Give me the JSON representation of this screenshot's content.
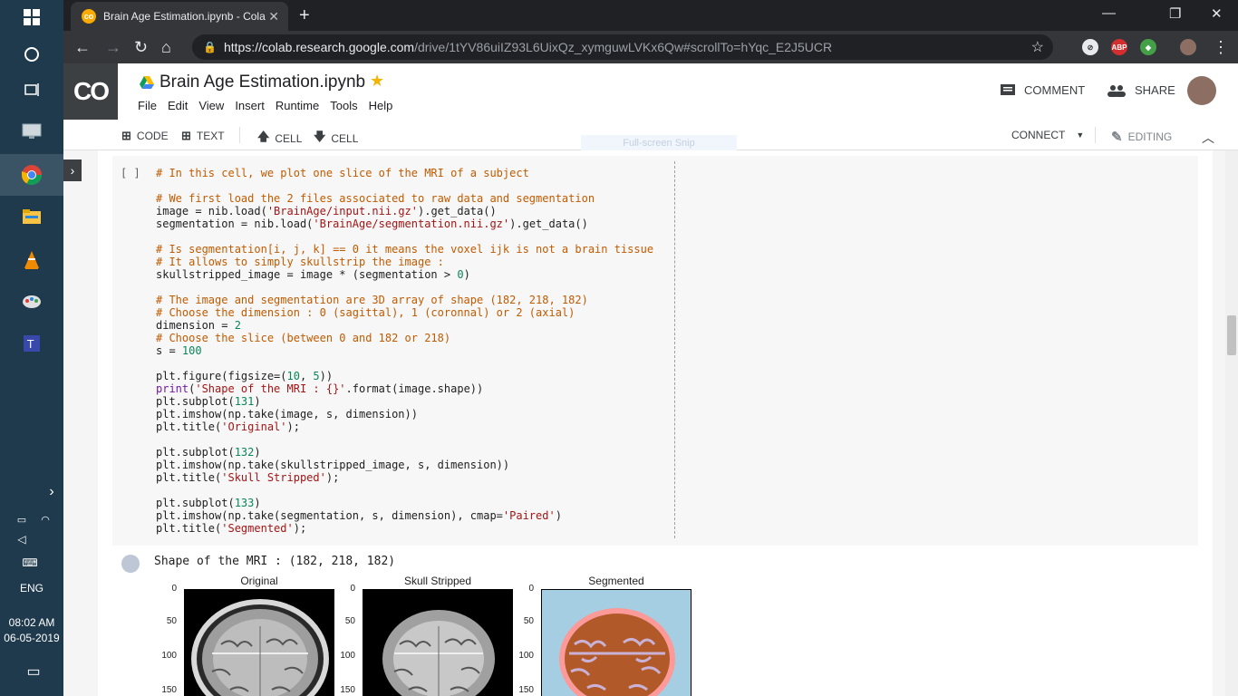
{
  "taskbar": {
    "time": "08:02 AM",
    "date": "06-05-2019",
    "language": "ENG"
  },
  "browser": {
    "tab_title": "Brain Age Estimation.ipynb - Cola",
    "url_host": "https://colab.research.google.com",
    "url_path": "/drive/1tYV86uiIZ93L6UixQz_xymguwLVKx6Qw#scrollTo=hYqc_E2J5UCR",
    "ext_abp": "ABP"
  },
  "colab": {
    "logo": "CO",
    "title": "Brain Age Estimation.ipynb",
    "menu": [
      "File",
      "Edit",
      "View",
      "Insert",
      "Runtime",
      "Tools",
      "Help"
    ],
    "comment_label": "COMMENT",
    "share_label": "SHARE"
  },
  "toolbar": {
    "code_label": "CODE",
    "text_label": "TEXT",
    "cell_up_label": "CELL",
    "cell_down_label": "CELL",
    "connect_label": "CONNECT",
    "editing_label": "EDITING",
    "snip_label": "Full-screen Snip"
  },
  "cell": {
    "run_indicator": "[ ]"
  },
  "output": {
    "text": "Shape of the MRI : (182, 218, 182)",
    "subplots": [
      {
        "title": "Original",
        "ticks": [
          "0",
          "50",
          "100",
          "150"
        ]
      },
      {
        "title": "Skull Stripped",
        "ticks": [
          "0",
          "50",
          "100",
          "150"
        ]
      },
      {
        "title": "Segmented",
        "ticks": [
          "0",
          "50",
          "100",
          "150"
        ]
      }
    ]
  },
  "colors": {
    "colab_dark": "#3c4043",
    "comment": "#c15b00",
    "string": "#a31515",
    "number": "#098658",
    "keyword": "#7319a7",
    "seg_background": "#a6cee3",
    "seg_outer": "#fb9a99",
    "seg_inner": "#b15928",
    "seg_white": "#cab2d6"
  }
}
